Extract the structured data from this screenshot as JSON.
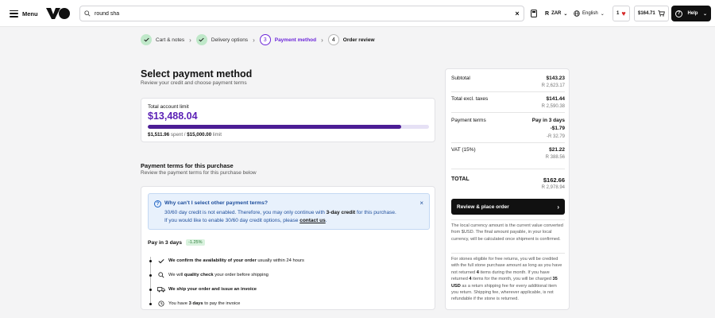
{
  "header": {
    "menu_label": "Menu",
    "search_value": "round sha",
    "currency": "ZAR",
    "language": "English",
    "wishlist_count": "1",
    "cart_total": "$164.71",
    "help_label": "Help"
  },
  "stepper": {
    "steps": [
      {
        "number": "",
        "label": "Cart & notes",
        "state": "done"
      },
      {
        "number": "",
        "label": "Delivery options",
        "state": "done"
      },
      {
        "number": "3",
        "label": "Payment method",
        "state": "current"
      },
      {
        "number": "4",
        "label": "Order review",
        "state": "todo"
      }
    ]
  },
  "main": {
    "title": "Select payment method",
    "subtitle": "Review your credit and choose payment terms",
    "limit": {
      "label": "Total account limit",
      "value": "$13,488.04",
      "spent": "$1,511.96",
      "spent_suffix": "spent / ",
      "total": "$15,000.00",
      "total_suffix": "limit",
      "progress_fraction": 0.9
    },
    "terms": {
      "title": "Payment terms for this purchase",
      "subtitle": "Review the payment terms for this purchase below",
      "alert": {
        "title": "Why can't I select other payment terms?",
        "body_1": "30/60 day credit is not enabled. Therefore, you may only continue with ",
        "body_bold": "3-day credit",
        "body_2": " for this purchase.",
        "body_3": "If you would like to enable 30/60 day credit options, please ",
        "link": "contact us",
        "body_4": "."
      },
      "option": {
        "title": "Pay in 3 days",
        "badge": "-1.25%",
        "steps": [
          {
            "bold": "We confirm the availability of your order",
            "rest": " usually within 24 hours",
            "icon": "check-icon"
          },
          {
            "pre": "We will ",
            "bold": "quality check",
            "rest": " your order before shipping",
            "icon": "magnifier-icon"
          },
          {
            "bold": "We ship your order and issue an invoice",
            "rest": "",
            "icon": "truck-icon"
          },
          {
            "pre": "You have ",
            "bold": "3 days",
            "rest": " to pay the invoice",
            "icon": "clock-icon"
          }
        ]
      }
    }
  },
  "summary": {
    "subtotal_label": "Subtotal",
    "subtotal_usd": "$143.23",
    "subtotal_zar": "R 2,623.17",
    "excl_label": "Total excl. taxes",
    "excl_usd": "$141.44",
    "excl_zar": "R 2,590.38",
    "terms_label": "Payment terms",
    "terms_value": "Pay in 3 days",
    "terms_usd": "-$1.79",
    "terms_zar": "-R 32.79",
    "vat_label": "VAT (15%)",
    "vat_usd": "$21.22",
    "vat_zar": "R 388.56",
    "total_label": "TOTAL",
    "total_usd": "$162.66",
    "total_zar": "R 2,978.94",
    "place_label": "Review & place order",
    "note_1": "The local currency amount is the current value converted from $USD. The final amount payable, in your local currency, will be calculated once shipment is confirmed.",
    "note_2a": "For stones eligible for free returns, you will be credited with the full stone purchase amount as long as you have not returned ",
    "note_2b": "4",
    "note_2c": " items during the month. If you have returned ",
    "note_2d": "4",
    "note_2e": " items for the month, you will be charged ",
    "note_2f": "35 USD",
    "note_2g": " as a return shipping fee for every additional item you return. Shipping fee, wherever applicable, is not refundable if the stone is returned."
  }
}
